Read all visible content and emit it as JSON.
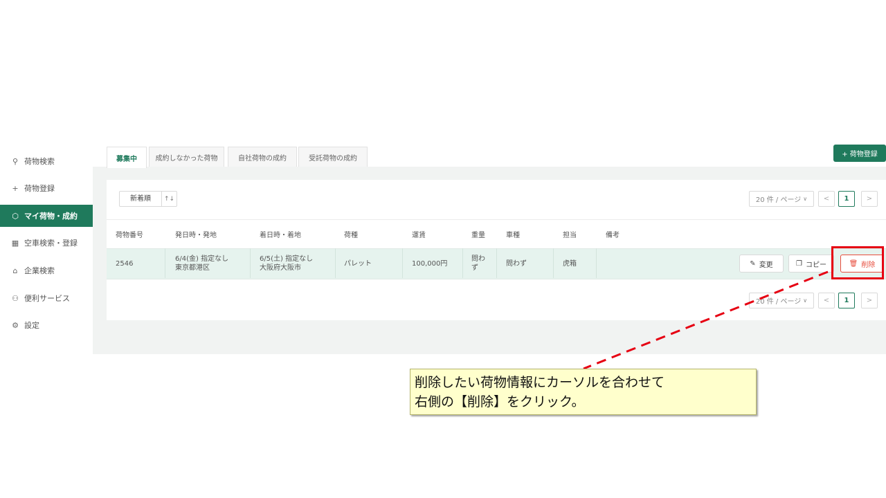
{
  "sidebar": {
    "items": [
      {
        "icon": "search-icon",
        "glyph": "⚲",
        "label": "荷物検索"
      },
      {
        "icon": "plus-icon",
        "glyph": "+",
        "label": "荷物登録"
      },
      {
        "icon": "cube-icon",
        "glyph": "⬡",
        "label": "マイ荷物・成約",
        "active": true
      },
      {
        "icon": "calendar-icon",
        "glyph": "▦",
        "label": "空車検索・登録"
      },
      {
        "icon": "home-icon",
        "glyph": "⌂",
        "label": "企業検索"
      },
      {
        "icon": "network-icon",
        "glyph": "⚇",
        "label": "便利サービス"
      },
      {
        "icon": "gear-icon",
        "glyph": "⚙",
        "label": "設定"
      }
    ]
  },
  "tabs": [
    "募集中",
    "成約しなかった荷物",
    "自社荷物の成約",
    "受託荷物の成約"
  ],
  "add_button": "+ 荷物登録",
  "sort": {
    "label": "新着順",
    "icon": "sort-icon",
    "glyph": "↑↓"
  },
  "pager": {
    "size_label": "20 件 / ページ",
    "prev": "<",
    "current": "1",
    "next": ">"
  },
  "table": {
    "headers": [
      "荷物番号",
      "発日時・発地",
      "着日時・着地",
      "荷種",
      "運賃",
      "重量",
      "車種",
      "担当",
      "備考"
    ],
    "rows": [
      {
        "no": "2546",
        "dep_date": "6/4(金) 指定なし",
        "dep_place": "東京都港区",
        "arr_date": "6/5(土) 指定なし",
        "arr_place": "大阪府大阪市",
        "kind": "パレット",
        "fare": "100,000円",
        "weight": "問わず",
        "vehicle": "問わず",
        "staff": "虎箱",
        "note": ""
      }
    ]
  },
  "actions": {
    "edit": "変更",
    "copy": "コピー",
    "delete": "削除"
  },
  "callout": {
    "line1": "削除したい荷物情報にカーソルを合わせて",
    "line2": "右側の【削除】をクリック。"
  },
  "colors": {
    "brand": "#1f7a5c",
    "highlight": "#e60012",
    "callout_bg": "#ffffcc"
  }
}
